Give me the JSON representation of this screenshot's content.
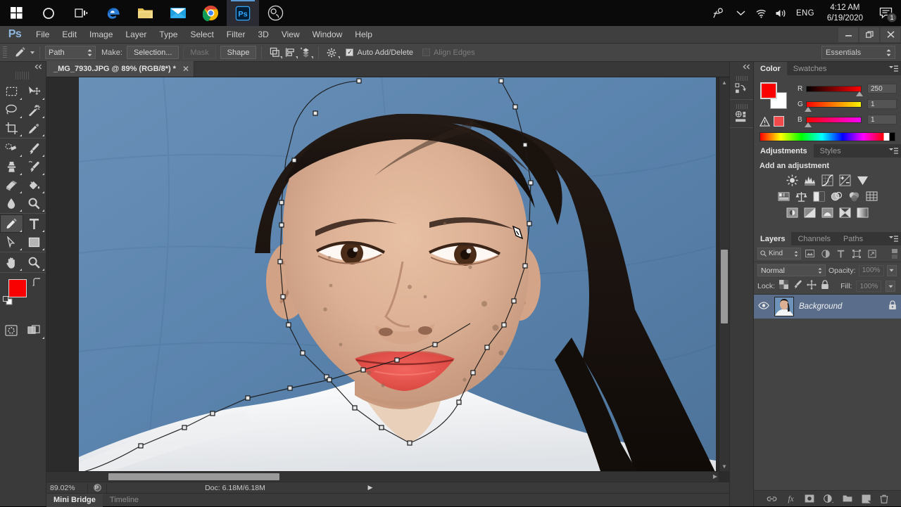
{
  "taskbar": {
    "apps": [
      {
        "name": "start-button",
        "icon": "windows-logo"
      },
      {
        "name": "cortana-button",
        "icon": "circle"
      },
      {
        "name": "task-view-button",
        "icon": "task-view"
      },
      {
        "name": "edge-button",
        "icon": "edge-logo"
      },
      {
        "name": "file-explorer-button",
        "icon": "folder"
      },
      {
        "name": "mail-button",
        "icon": "envelope"
      },
      {
        "name": "chrome-button",
        "icon": "chrome-logo"
      },
      {
        "name": "photoshop-button",
        "icon": "photoshop-logo"
      },
      {
        "name": "obs-button",
        "icon": "obs-logo"
      }
    ],
    "language": "ENG",
    "time": "4:12 AM",
    "date": "6/19/2020",
    "notification_count": "1"
  },
  "menubar": {
    "logo": "Ps",
    "items": [
      "File",
      "Edit",
      "Image",
      "Layer",
      "Type",
      "Select",
      "Filter",
      "3D",
      "View",
      "Window",
      "Help"
    ],
    "window_controls": {
      "minimize": "—",
      "restore": "❐",
      "close": "✕"
    }
  },
  "options_bar": {
    "tool": "pen-tool",
    "mode_value": "Path",
    "make_label": "Make:",
    "selection_button": "Selection...",
    "mask_button": "Mask",
    "shape_button": "Shape",
    "path_operations_icon": "path-operations-icon",
    "path_alignment_icon": "path-alignment-icon",
    "path_arrangement_icon": "path-arrangement-icon",
    "settings_icon": "gear-icon",
    "auto_add_delete_label": "Auto Add/Delete",
    "auto_add_delete_checked": true,
    "align_edges_label": "Align Edges",
    "align_edges_checked": false,
    "workspace": "Essentials"
  },
  "toolbox": {
    "selected_tool": "pen-tool",
    "groups": [
      [
        [
          "marquee-tool",
          "move-tool"
        ],
        [
          "lasso-tool",
          "magic-wand-tool"
        ],
        [
          "crop-tool",
          "eyedropper-tool"
        ]
      ],
      [
        [
          "spot-healing-brush-tool",
          "brush-tool"
        ],
        [
          "clone-stamp-tool",
          "history-brush-tool"
        ],
        [
          "eraser-tool",
          "paint-bucket-tool"
        ],
        [
          "blur-tool",
          "dodge-tool"
        ]
      ],
      [
        [
          "pen-tool",
          "type-tool"
        ],
        [
          "path-selection-tool",
          "rectangle-tool"
        ]
      ],
      [
        [
          "hand-tool",
          "zoom-tool"
        ]
      ]
    ],
    "foreground_color": "#fa0101",
    "background_color": "#ffffff",
    "quick_mask_icon": "quick-mask-icon",
    "screen_mode_icon": "screen-mode-icon"
  },
  "document": {
    "tab_title": "_MG_7930.JPG @ 89% (RGB/8*) *",
    "close_label": "✕",
    "zoom": "89.02%",
    "doc_info": "Doc: 6.18M/6.18M",
    "background_color": "#5b84ae"
  },
  "bottom_bar": {
    "tabs": [
      {
        "label": "Mini Bridge",
        "active": true
      },
      {
        "label": "Timeline",
        "active": false
      }
    ]
  },
  "panels": {
    "color": {
      "tabs": [
        {
          "label": "Color",
          "active": true
        },
        {
          "label": "Swatches",
          "active": false
        }
      ],
      "channels": [
        {
          "label": "R",
          "value": "250",
          "pos": 96
        },
        {
          "label": "G",
          "value": "1",
          "pos": 2
        },
        {
          "label": "B",
          "value": "1",
          "pos": 2
        }
      ],
      "foreground": "#fa0101",
      "background": "#ffffff",
      "out_of_gamut_icon": "warning-triangle-icon",
      "out_of_gamut_swatch": "#f24a4a"
    },
    "adjustments": {
      "tabs": [
        {
          "label": "Adjustments",
          "active": true
        },
        {
          "label": "Styles",
          "active": false
        }
      ],
      "title": "Add an adjustment",
      "icons": [
        [
          "brightness-contrast-icon",
          "levels-icon",
          "curves-icon",
          "exposure-icon",
          "vibrance-icon"
        ],
        [
          "hue-saturation-icon",
          "color-balance-icon",
          "black-white-icon",
          "photo-filter-icon",
          "channel-mixer-icon",
          "color-lookup-icon"
        ],
        [
          "invert-icon",
          "posterize-icon",
          "threshold-icon",
          "selective-color-icon",
          "gradient-map-icon"
        ]
      ]
    },
    "layers": {
      "tabs": [
        {
          "label": "Layers",
          "active": true
        },
        {
          "label": "Channels",
          "active": false
        },
        {
          "label": "Paths",
          "active": false
        }
      ],
      "filter_kind": "Kind",
      "filter_icons": [
        "filter-pixel-icon",
        "filter-adjustment-icon",
        "filter-type-icon",
        "filter-shape-icon",
        "filter-smart-icon"
      ],
      "blend_mode": "Normal",
      "opacity_label": "Opacity:",
      "opacity_value": "100%",
      "lock_label": "Lock:",
      "lock_icons": [
        "lock-transparent-pixels-icon",
        "lock-image-pixels-icon",
        "lock-position-icon",
        "lock-all-icon"
      ],
      "fill_label": "Fill:",
      "fill_value": "100%",
      "rows": [
        {
          "name": "Background",
          "visible": true,
          "locked": true,
          "thumbnail": "portrait-thumbnail"
        }
      ],
      "footer_icons": [
        "link-layers-icon",
        "layer-style-fx-icon",
        "add-layer-mask-icon",
        "new-adjustment-layer-icon",
        "new-group-icon",
        "new-layer-icon",
        "delete-layer-icon"
      ]
    },
    "rail": {
      "collapse_icon": "collapse-panels-icon",
      "items": [
        "history-panel-icon",
        "properties-panel-icon"
      ]
    }
  }
}
